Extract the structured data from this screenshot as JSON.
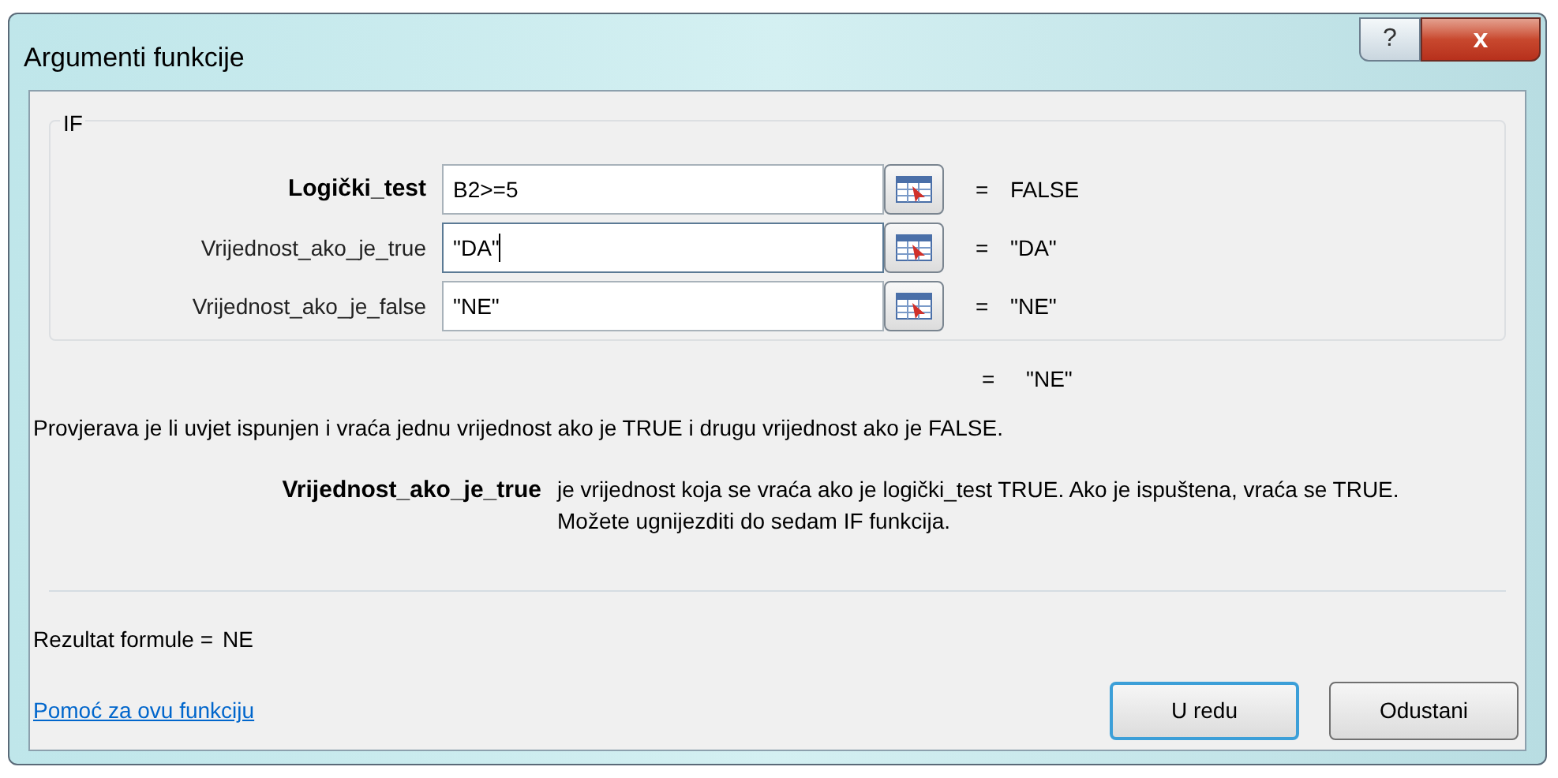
{
  "window": {
    "title": "Argumenti funkcije",
    "help_button": "?",
    "close_button": "x"
  },
  "function_name": "IF",
  "arguments": [
    {
      "label": "Logički_test",
      "required": true,
      "value": "B2>=5",
      "focused": false,
      "result": "FALSE"
    },
    {
      "label": "Vrijednost_ako_je_true",
      "required": false,
      "value": "\"DA\"",
      "focused": true,
      "result": "\"DA\""
    },
    {
      "label": "Vrijednost_ako_je_false",
      "required": false,
      "value": "\"NE\"",
      "focused": false,
      "result": "\"NE\""
    }
  ],
  "equals_sign": "=",
  "function_result": "\"NE\"",
  "description": "Provjerava je li uvjet ispunjen i vraća jednu vrijednost ako je TRUE i drugu vrijednost ako je FALSE.",
  "argument_help": {
    "name": "Vrijednost_ako_je_true",
    "text": "je vrijednost koja se vraća ako je logički_test TRUE. Ako je ispuštena, vraća se TRUE. Možete ugnijezditi do sedam IF funkcija."
  },
  "formula_result": {
    "label": "Rezultat formule =",
    "value": "NE"
  },
  "help_link": "Pomoć za ovu funkciju",
  "buttons": [
    {
      "label": "U redu",
      "default": true
    },
    {
      "label": "Odustani",
      "default": false
    }
  ]
}
